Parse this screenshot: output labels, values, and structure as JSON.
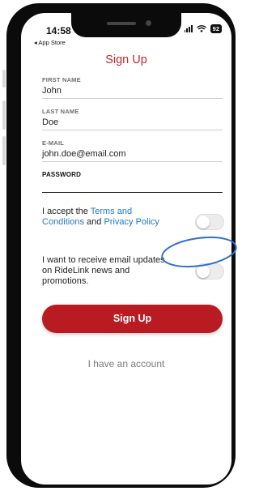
{
  "status_bar": {
    "time": "14:58",
    "back_app": "◂ App Store",
    "battery": "92"
  },
  "nav": {
    "title": "Sign Up"
  },
  "form": {
    "first_name": {
      "label": "FIRST NAME",
      "value": "John"
    },
    "last_name": {
      "label": "LAST NAME",
      "value": "Doe"
    },
    "email": {
      "label": "E-MAIL",
      "value": "john.doe@email.com"
    },
    "password": {
      "label": "PASSWORD",
      "value": ""
    }
  },
  "terms": {
    "prefix": "I accept the ",
    "terms_link": "Terms and Conditions",
    "middle": " and ",
    "privacy_link": "Privacy Policy",
    "enabled": false
  },
  "marketing": {
    "text": "I want to receive email updates on RideLink news and promotions.",
    "enabled": false
  },
  "buttons": {
    "sign_up": "Sign Up",
    "have_account": "I have an account"
  },
  "colors": {
    "brand": "#b81c22",
    "link": "#1e78c8",
    "annotation": "#2f6fd0"
  }
}
